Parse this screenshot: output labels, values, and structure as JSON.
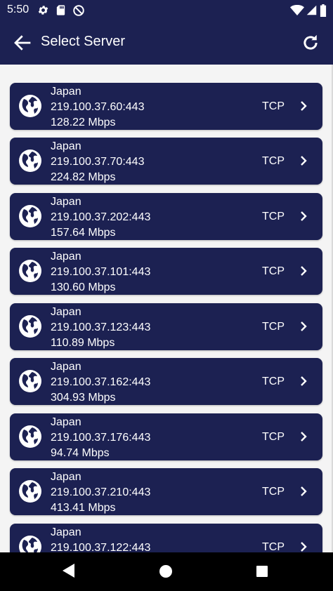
{
  "status_bar": {
    "time": "5:50",
    "icons": [
      "settings-gear-icon",
      "sd-card-icon",
      "no-disturb-icon",
      "wifi-icon",
      "cell-signal-icon",
      "battery-icon"
    ]
  },
  "app_bar": {
    "title": "Select Server",
    "back_icon": "arrow-back-icon",
    "refresh_icon": "refresh-icon"
  },
  "colors": {
    "primary": "#1c2152",
    "background": "#f4f4f4",
    "text_on_primary": "#ffffff"
  },
  "servers": [
    {
      "country": "Japan",
      "address": "219.100.37.60:443",
      "speed": "128.22 Mbps",
      "protocol": "TCP"
    },
    {
      "country": "Japan",
      "address": "219.100.37.70:443",
      "speed": "224.82 Mbps",
      "protocol": "TCP"
    },
    {
      "country": "Japan",
      "address": "219.100.37.202:443",
      "speed": "157.64 Mbps",
      "protocol": "TCP"
    },
    {
      "country": "Japan",
      "address": "219.100.37.101:443",
      "speed": "130.60 Mbps",
      "protocol": "TCP"
    },
    {
      "country": "Japan",
      "address": "219.100.37.123:443",
      "speed": "110.89 Mbps",
      "protocol": "TCP"
    },
    {
      "country": "Japan",
      "address": "219.100.37.162:443",
      "speed": "304.93 Mbps",
      "protocol": "TCP"
    },
    {
      "country": "Japan",
      "address": "219.100.37.176:443",
      "speed": "94.74 Mbps",
      "protocol": "TCP"
    },
    {
      "country": "Japan",
      "address": "219.100.37.210:443",
      "speed": "413.41 Mbps",
      "protocol": "TCP"
    },
    {
      "country": "Japan",
      "address": "219.100.37.122:443",
      "speed": "",
      "protocol": "TCP"
    }
  ],
  "nav_bar": {
    "icons": [
      "nav-back-icon",
      "nav-home-icon",
      "nav-recents-icon"
    ]
  }
}
